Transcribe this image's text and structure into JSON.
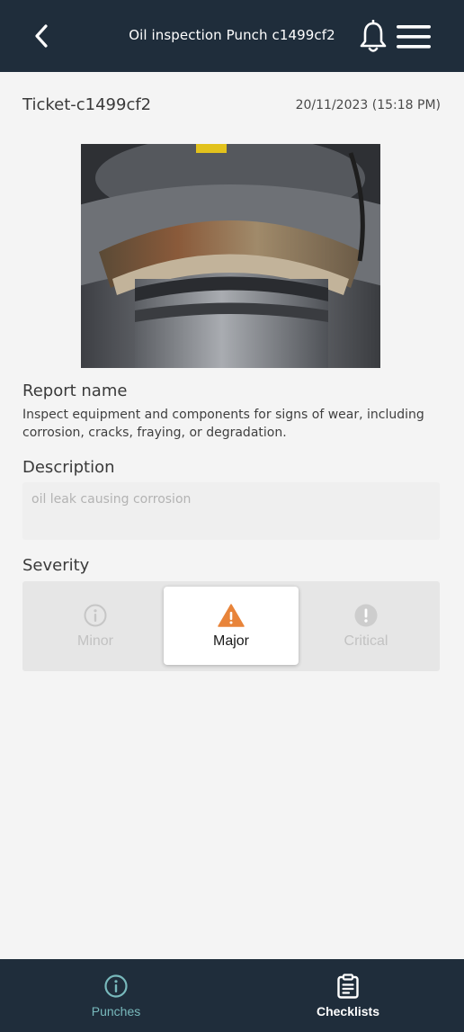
{
  "header": {
    "title": "Oil inspection Punch c1499cf2"
  },
  "ticket": {
    "id": "Ticket-c1499cf2",
    "date": "20/11/2023 (15:18 PM)"
  },
  "report": {
    "label": "Report name",
    "text": "Inspect equipment and components for signs of wear, including corrosion, cracks, fraying, or degradation."
  },
  "description": {
    "label": "Description",
    "value": "oil leak causing corrosion"
  },
  "severity": {
    "label": "Severity",
    "selected": "Major",
    "options": [
      {
        "label": "Minor",
        "icon": "info-circle-icon"
      },
      {
        "label": "Major",
        "icon": "warning-triangle-icon",
        "color": "#e8843a"
      },
      {
        "label": "Critical",
        "icon": "exclamation-circle-icon"
      }
    ]
  },
  "nav": {
    "items": [
      {
        "label": "Punches",
        "icon": "info-circle-icon",
        "color": "#78b9bc"
      },
      {
        "label": "Checklists",
        "icon": "clipboard-icon",
        "color": "#ffffff"
      }
    ]
  },
  "colors": {
    "header_bg": "#1f2d3b",
    "page_bg": "#f4f4f4",
    "accent": "#78b9bc",
    "major": "#e8843a"
  }
}
